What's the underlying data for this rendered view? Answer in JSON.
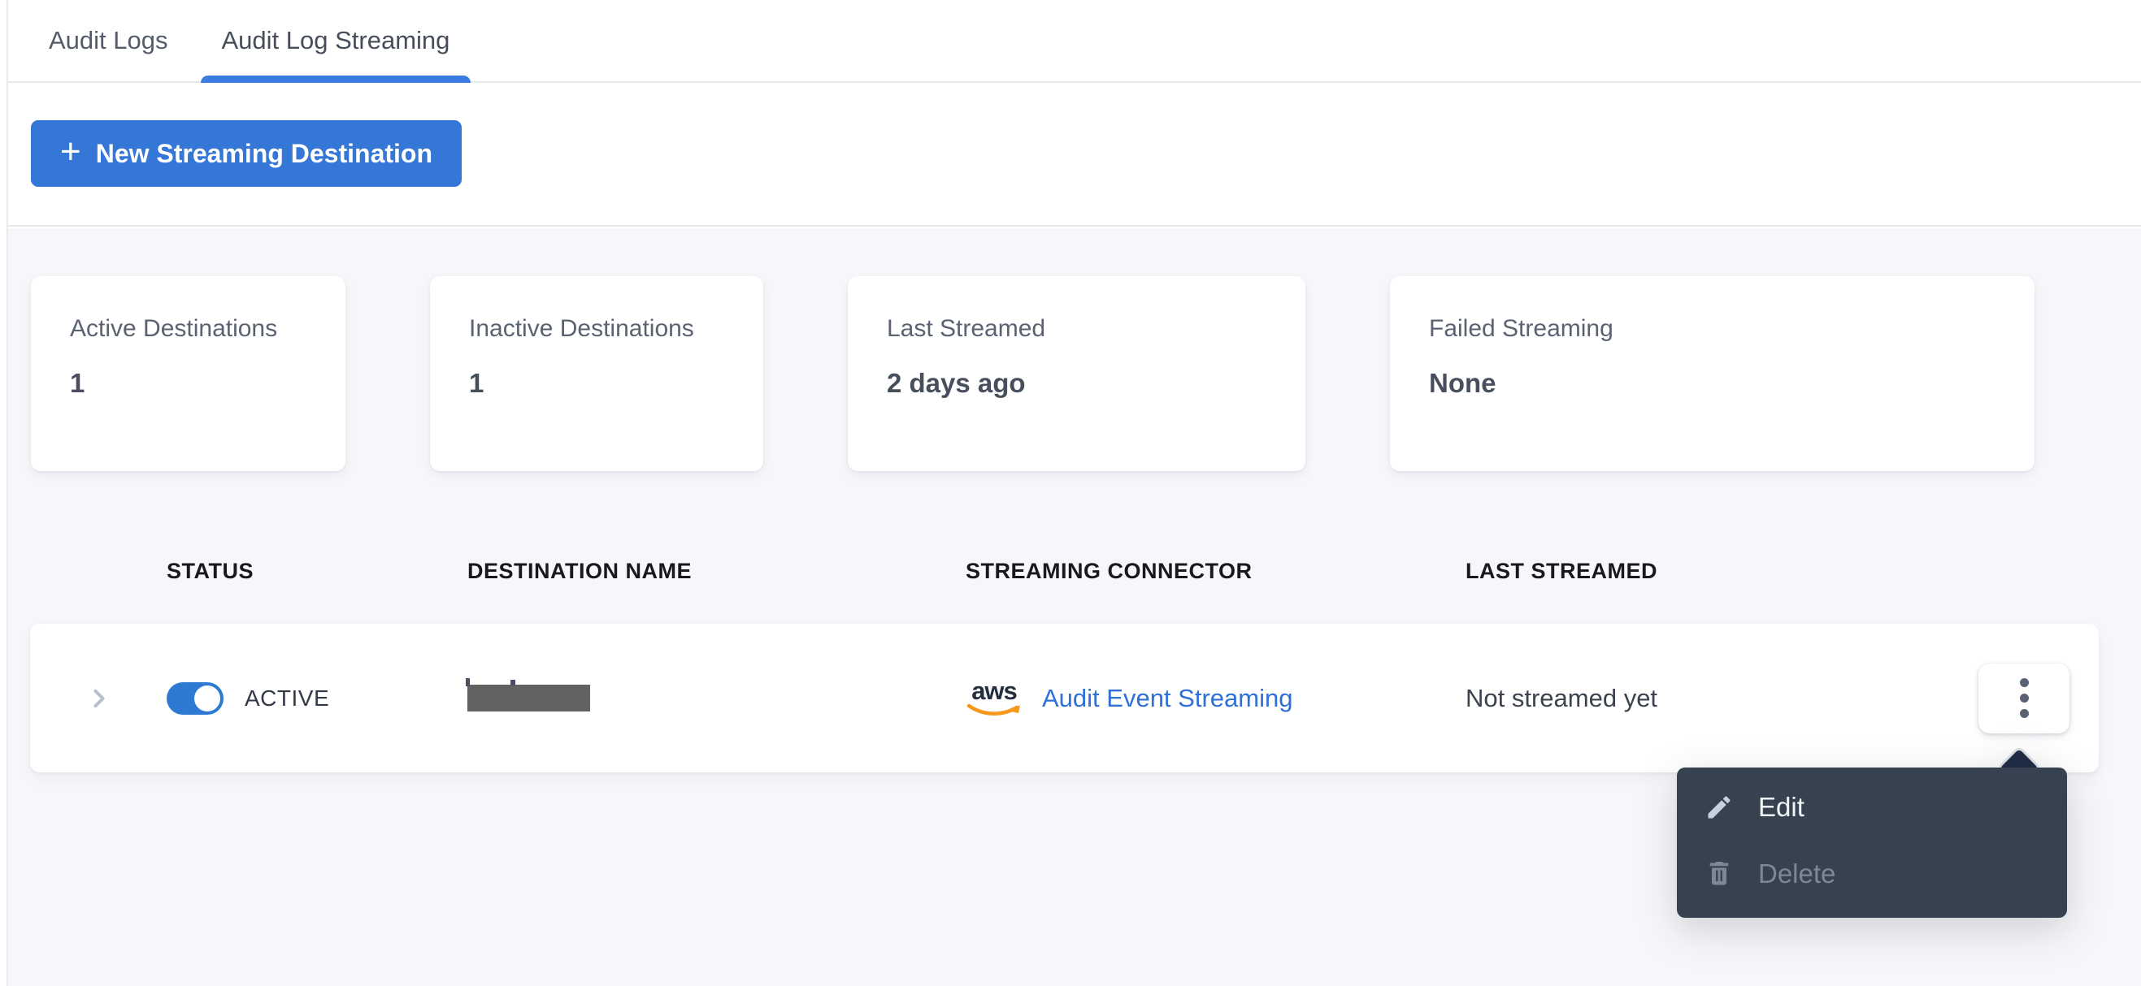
{
  "tabs": [
    {
      "label": "Audit Logs",
      "active": false
    },
    {
      "label": "Audit Log Streaming",
      "active": true
    }
  ],
  "toolbar": {
    "plus_icon": "+",
    "new_destination_label": "New Streaming Destination"
  },
  "stats": [
    {
      "label": "Active Destinations",
      "value": "1"
    },
    {
      "label": "Inactive Destinations",
      "value": "1"
    },
    {
      "label": "Last Streamed",
      "value": "2 days ago"
    },
    {
      "label": "Failed Streaming",
      "value": "None"
    }
  ],
  "table": {
    "columns": [
      "STATUS",
      "DESTINATION NAME",
      "STREAMING CONNECTOR",
      "LAST STREAMED"
    ],
    "rows": [
      {
        "toggle_on": true,
        "status_label": "ACTIVE",
        "destination_name": "",
        "destination_name_redacted": true,
        "connector": {
          "provider_logo": "aws",
          "label": "Audit Event Streaming"
        },
        "last_streamed": "Not streamed yet"
      }
    ]
  },
  "menu": {
    "items": [
      {
        "label": "Edit",
        "icon": "pencil-icon",
        "enabled": true
      },
      {
        "label": "Delete",
        "icon": "trash-icon",
        "enabled": false
      }
    ]
  },
  "colors": {
    "accent_blue": "#3477d6",
    "tab_underline_blue": "#3b7ce0",
    "toggle_blue": "#2e79d4",
    "link_blue": "#2e6fd8",
    "menu_background": "#36424f",
    "menu_caret": "#1e2b42",
    "aws_orange": "#f7981d",
    "redaction_gray": "#626262",
    "page_background": "#f6f7fa"
  }
}
